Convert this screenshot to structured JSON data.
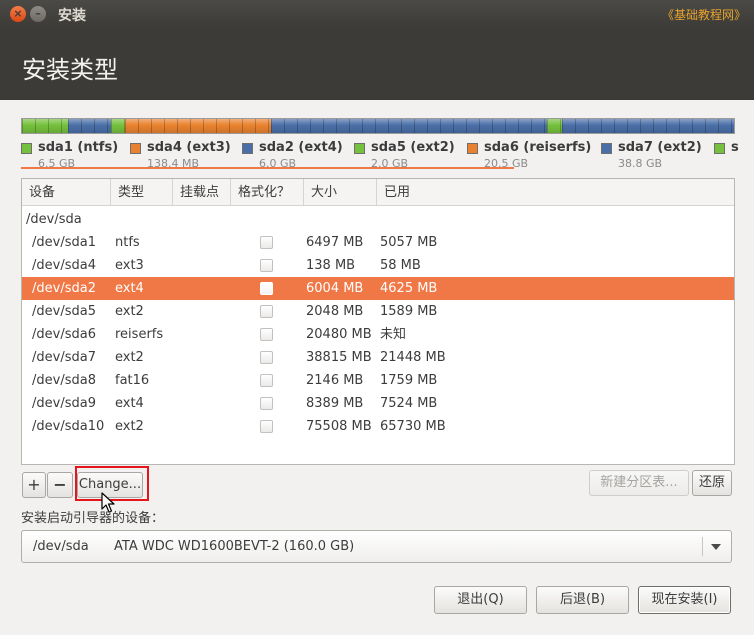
{
  "window": {
    "title": "安装",
    "watermark": "《基础教程网》"
  },
  "header": {
    "title": "安装类型"
  },
  "partition_bar": [
    {
      "color": "#75c03c",
      "weight": 6.5
    },
    {
      "color": "#4a6fa8",
      "weight": 6.0
    },
    {
      "color": "#75c03c",
      "weight": 2.0
    },
    {
      "color": "#e9822f",
      "weight": 20.5
    },
    {
      "color": "#4a6fa8",
      "weight": 38.8
    },
    {
      "color": "#75c03c",
      "weight": 2.1
    },
    {
      "color": "#4a6fa8",
      "weight": 24.1
    }
  ],
  "legend": [
    {
      "name": "sda1 (ntfs)",
      "size": "6.5 GB",
      "color": "#75c03c"
    },
    {
      "name": "sda4 (ext3)",
      "size": "138.4 MB",
      "color": "#e9822f"
    },
    {
      "name": "sda2 (ext4)",
      "size": "6.0 GB",
      "color": "#4a6fa8"
    },
    {
      "name": "sda5 (ext2)",
      "size": "2.0 GB",
      "color": "#75c03c"
    },
    {
      "name": "sda6 (reiserfs)",
      "size": "20.5 GB",
      "color": "#e9822f"
    },
    {
      "name": "sda7 (ext2)",
      "size": "38.8 GB",
      "color": "#4a6fa8"
    },
    {
      "name": "s",
      "size": "",
      "color": "#75c03c"
    }
  ],
  "table": {
    "headers": {
      "device": "设备",
      "type": "类型",
      "mount": "挂载点",
      "format": "格式化？",
      "size": "大小",
      "used": "已用"
    },
    "disk": "/dev/sda",
    "rows": [
      {
        "device": "/dev/sda1",
        "type": "ntfs",
        "mount": "",
        "size": "6497 MB",
        "used": "5057 MB",
        "selected": false
      },
      {
        "device": "/dev/sda4",
        "type": "ext3",
        "mount": "",
        "size": "138 MB",
        "used": "58 MB",
        "selected": false
      },
      {
        "device": "/dev/sda2",
        "type": "ext4",
        "mount": "",
        "size": "6004 MB",
        "used": "4625 MB",
        "selected": true
      },
      {
        "device": "/dev/sda5",
        "type": "ext2",
        "mount": "",
        "size": "2048 MB",
        "used": "1589 MB",
        "selected": false
      },
      {
        "device": "/dev/sda6",
        "type": "reiserfs",
        "mount": "",
        "size": "20480 MB",
        "used": "未知",
        "selected": false
      },
      {
        "device": "/dev/sda7",
        "type": "ext2",
        "mount": "",
        "size": "38815 MB",
        "used": "21448 MB",
        "selected": false
      },
      {
        "device": "/dev/sda8",
        "type": "fat16",
        "mount": "",
        "size": "2146 MB",
        "used": "1759 MB",
        "selected": false
      },
      {
        "device": "/dev/sda9",
        "type": "ext4",
        "mount": "",
        "size": "8389 MB",
        "used": "7524 MB",
        "selected": false
      },
      {
        "device": "/dev/sda10",
        "type": "ext2",
        "mount": "",
        "size": "75508 MB",
        "used": "65730 MB",
        "selected": false
      }
    ]
  },
  "toolbar": {
    "add_label": "+",
    "remove_label": "−",
    "change_label": "Change...",
    "new_table_label": "新建分区表...",
    "revert_label": "还原"
  },
  "boot": {
    "label": "安装启动引导器的设备：",
    "device": "/dev/sda",
    "model": "ATA WDC WD1600BEVT-2 (160.0 GB)"
  },
  "footer": {
    "quit_label": "退出(Q)",
    "back_label": "后退(B)",
    "install_label": "现在安装(I)"
  }
}
